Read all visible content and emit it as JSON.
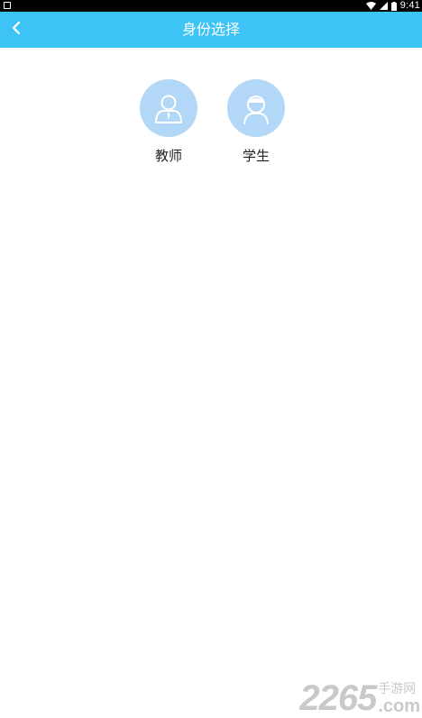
{
  "status_bar": {
    "time": "9:41",
    "icons": [
      "notification-icon",
      "wifi-icon",
      "signal-icon",
      "battery-icon"
    ]
  },
  "header": {
    "title": "身份选择",
    "back_icon": "chevron-left-icon",
    "background_color": "#3ec3f6"
  },
  "roles": [
    {
      "label": "教师",
      "icon": "teacher-avatar-icon"
    },
    {
      "label": "学生",
      "icon": "student-avatar-icon"
    }
  ],
  "watermark": {
    "number": "2265",
    "text": "手游网",
    "domain_suffix": ".com"
  }
}
